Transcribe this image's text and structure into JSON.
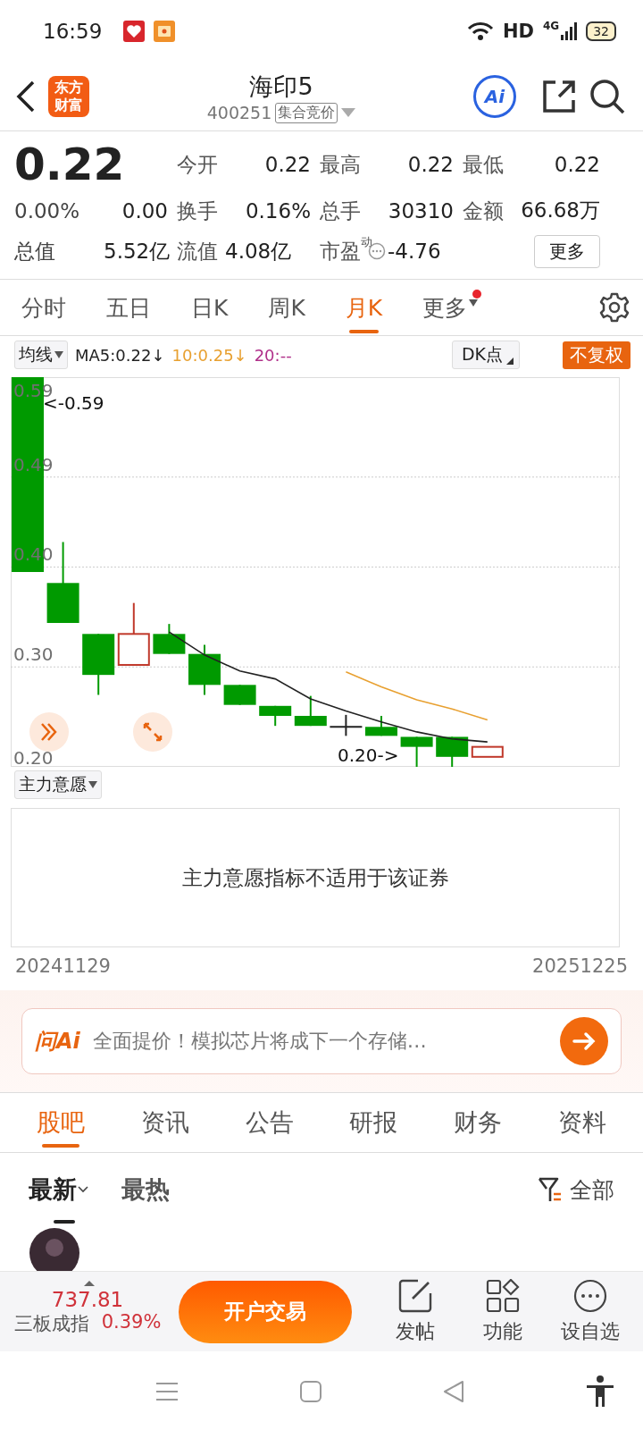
{
  "status_bar": {
    "time": "16:59",
    "network": "HD",
    "mobile": "4G",
    "battery": "32"
  },
  "header": {
    "logo_text": "东方财富",
    "title": "海印5",
    "code": "400251",
    "badge": "集合竞价",
    "ai_label": "Ai"
  },
  "quote": {
    "price": "0.22",
    "change_pct": "0.00%",
    "change": "0.00",
    "total_value": {
      "label": "总值",
      "value": "5.52亿"
    },
    "stats": [
      {
        "label": "今开",
        "value": "0.22"
      },
      {
        "label": "最高",
        "value": "0.22"
      },
      {
        "label": "最低",
        "value": "0.22"
      },
      {
        "label": "换手",
        "value": "0.16%"
      },
      {
        "label": "总手",
        "value": "30310"
      },
      {
        "label": "金额",
        "value": "66.68万"
      },
      {
        "label": "流值",
        "value": "4.08亿"
      },
      {
        "label": "市盈$^{动}$",
        "value": "-4.76"
      }
    ],
    "more_button": "更多"
  },
  "chart_tabs": [
    {
      "label": "分时",
      "selected": false,
      "kind": "tab"
    },
    {
      "label": "五日",
      "selected": false,
      "kind": "tab"
    },
    {
      "label": "日K",
      "selected": false,
      "kind": "tab"
    },
    {
      "label": "周K",
      "selected": false,
      "kind": "tab"
    },
    {
      "label": "月K",
      "selected": true,
      "kind": "tab"
    },
    {
      "label": "更多",
      "selected": false,
      "kind": "menu",
      "badge": true
    }
  ],
  "indicator_bar": {
    "dropdown": "均线",
    "readings": [
      {
        "text": "MA5:0.22↓",
        "color": "#222222"
      },
      {
        "text": "10:0.25↓",
        "color": "#e8a030"
      },
      {
        "text": "20:--",
        "color": "#b0308a"
      }
    ],
    "dk": "DK点",
    "adjust": "不复权"
  },
  "price_chart": {
    "axis_labels": [
      "0.59",
      "0.49",
      "0.40",
      "0.30",
      "0.20"
    ],
    "high_marker": "<-0.59",
    "low_marker": "0.20->"
  },
  "sub_indicator": {
    "dropdown": "主力意愿",
    "message": "主力意愿指标不适用于该证券"
  },
  "date_range": {
    "start": "20241129",
    "end": "20251225"
  },
  "ai_banner": {
    "logo": "问Ai",
    "query": "全面提价！模拟芯片将成下一个存储…"
  },
  "news_tabs": [
    {
      "label": "股吧",
      "selected": true
    },
    {
      "label": "资讯",
      "selected": false
    },
    {
      "label": "公告",
      "selected": false
    },
    {
      "label": "研报",
      "selected": false
    },
    {
      "label": "财务",
      "selected": false
    },
    {
      "label": "资料",
      "selected": false
    }
  ],
  "sort_tabs": [
    {
      "label": "最新",
      "selected": true
    },
    {
      "label": "最热",
      "selected": false
    }
  ],
  "filter": "全部",
  "bottom_bar": {
    "index_value": "737.81",
    "index_name": "三板成指",
    "index_pct": "0.39%",
    "trade_button": "开户交易",
    "actions": [
      {
        "label": "发帖",
        "kind": "post"
      },
      {
        "label": "功能",
        "kind": "apps"
      },
      {
        "label": "设自选",
        "kind": "more"
      }
    ]
  }
}
